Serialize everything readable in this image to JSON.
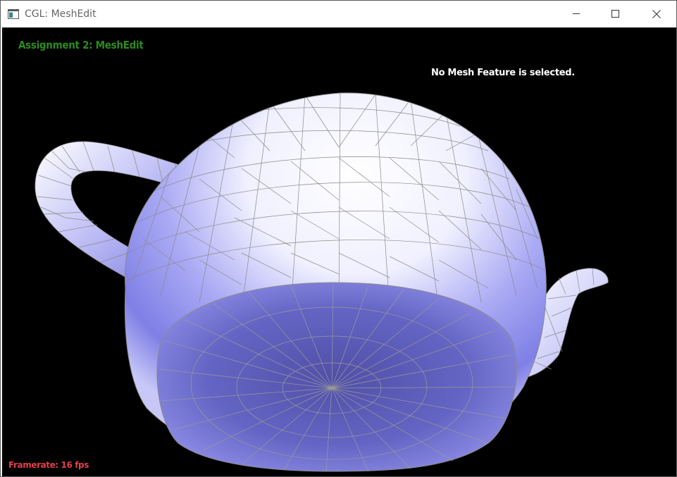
{
  "window": {
    "title": "CGL: MeshEdit",
    "icon": "app-window-icon",
    "controls": {
      "minimize": "minimize-icon",
      "maximize": "maximize-icon",
      "close": "close-icon"
    }
  },
  "viewport": {
    "background": "#000000",
    "hud": {
      "title": "Assignment 2: MeshEdit",
      "selection_status": "No Mesh Feature is selected.",
      "framerate_label": "Framerate: 16 fps"
    },
    "colors": {
      "title": "#2d8a1f",
      "selection_status": "#ffffff",
      "framerate": "#e0404a",
      "mesh_fill": "#8c8cf0",
      "mesh_highlight": "#ffffff",
      "wireframe": "#8a8a8a"
    },
    "model": "teapot-mesh"
  }
}
